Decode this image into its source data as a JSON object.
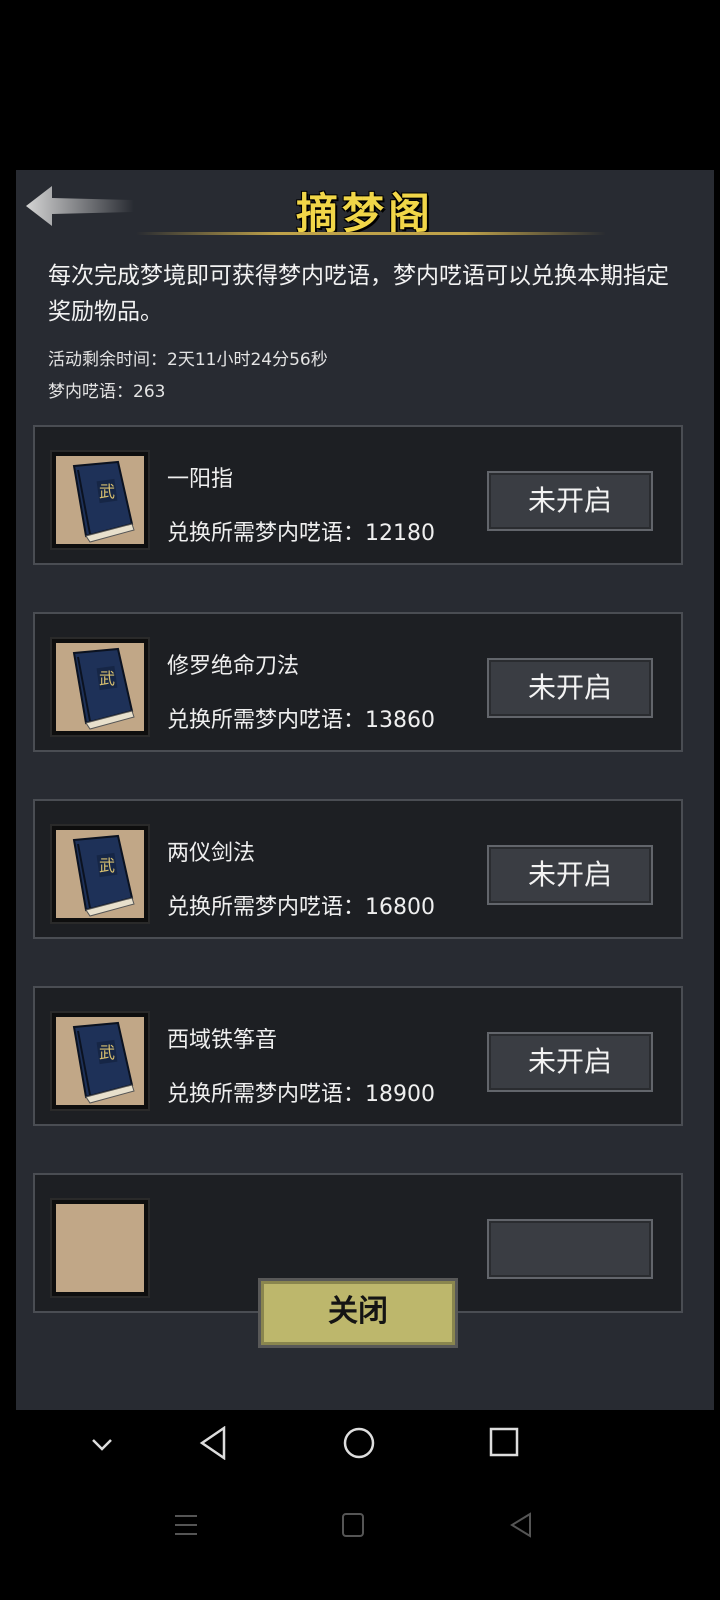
{
  "header": {
    "title": "摘梦阁"
  },
  "description": "每次完成梦境即可获得梦内呓语，梦内呓语可以兑换本期指定奖励物品。",
  "activity_time": "活动剩余时间：2天11小时24分56秒",
  "currency": "梦内呓语：263",
  "items": [
    {
      "name": "一阳指",
      "cost": "兑换所需梦内呓语：12180",
      "status": "未开启",
      "icon_char": "武"
    },
    {
      "name": "修罗绝命刀法",
      "cost": "兑换所需梦内呓语：13860",
      "status": "未开启",
      "icon_char": "武"
    },
    {
      "name": "两仪剑法",
      "cost": "兑换所需梦内呓语：16800",
      "status": "未开启",
      "icon_char": "武"
    },
    {
      "name": "西域铁筝音",
      "cost": "兑换所需梦内呓语：18900",
      "status": "未开启",
      "icon_char": "武"
    }
  ],
  "close_label": "关闭",
  "icons": [
    "back-arrow-icon",
    "book-icon",
    "nav-down-icon",
    "nav-back-icon",
    "nav-home-icon",
    "nav-recent-icon",
    "menu-icon"
  ],
  "colors": {
    "title": "#f1d648",
    "panel": "#282b32",
    "close_button": "#bdb76c"
  }
}
